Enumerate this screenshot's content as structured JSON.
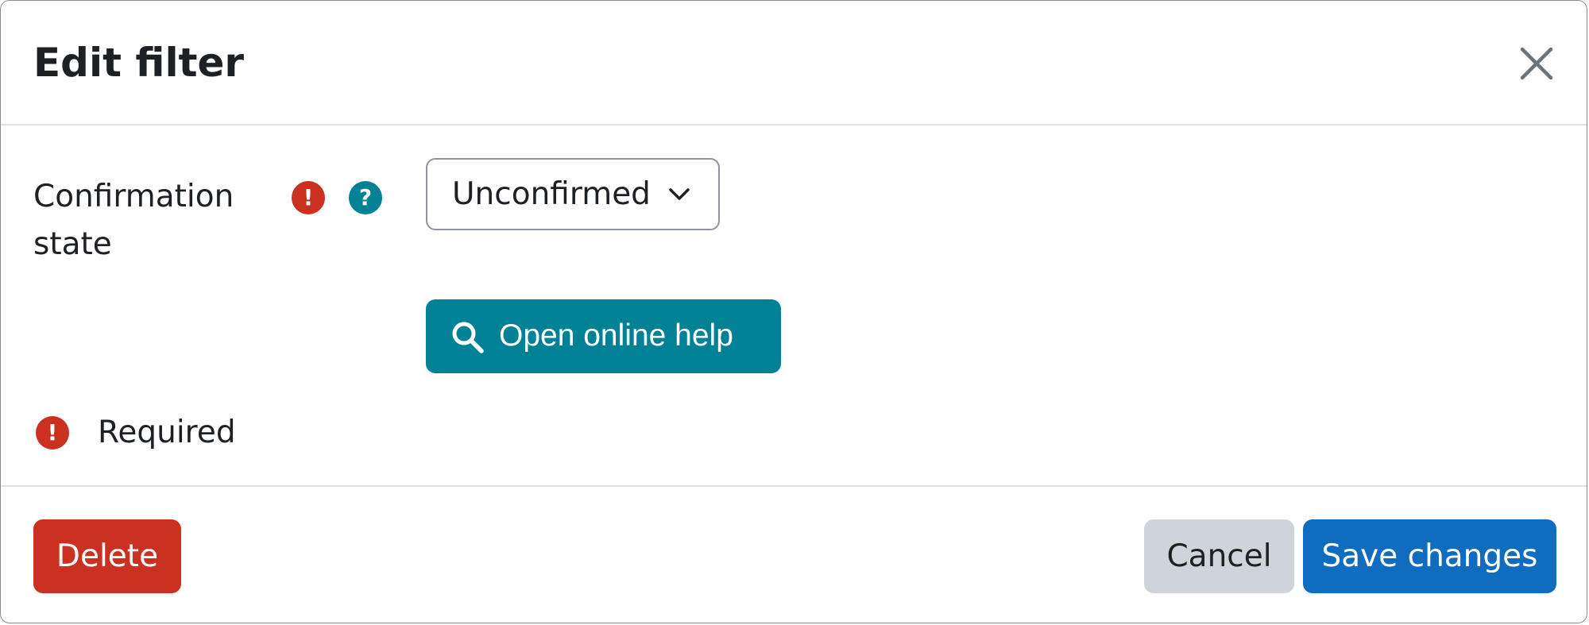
{
  "dialog": {
    "title": "Edit filter",
    "close_icon": "close-icon"
  },
  "form": {
    "field_label": "Confirmation state",
    "required_icon": "exclamation-icon",
    "required_icon_glyph": "!",
    "help_icon": "question-icon",
    "help_icon_glyph": "?",
    "select": {
      "selected_value": "Unconfirmed",
      "chevron_icon": "chevron-down-icon"
    },
    "help_button": {
      "label": "Open online help",
      "icon": "search-icon"
    },
    "required_note": {
      "icon": "exclamation-icon",
      "icon_glyph": "!",
      "text": "Required"
    }
  },
  "footer": {
    "delete_label": "Delete",
    "cancel_label": "Cancel",
    "save_label": "Save changes"
  },
  "colors": {
    "danger": "#ca3120",
    "info": "#008196",
    "primary": "#0f6cbf",
    "secondary": "#ced4da",
    "text": "#1d2125",
    "divider": "#dee2e6"
  }
}
